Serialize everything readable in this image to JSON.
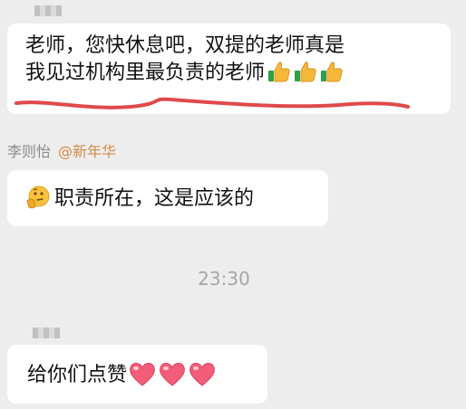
{
  "messages": [
    {
      "line1": "老师，您快休息吧，双提的老师真是",
      "line2": "我见过机构里最负责的老师",
      "emojis": [
        "thumbs-up",
        "thumbs-up",
        "thumbs-up"
      ]
    },
    {
      "sender_name": "李则怡",
      "mention": "@新年华",
      "text": "职责所在，这是应该的",
      "emoji": "thinking-face"
    },
    {
      "text": "给你们点赞",
      "emojis": [
        "heart",
        "heart",
        "heart"
      ]
    }
  ],
  "timestamp": "23:30",
  "colors": {
    "background": "#ededed",
    "bubble": "#ffffff",
    "underline": "#e0494b",
    "mention": "#d48a45",
    "timestamp": "#a6a6a6"
  }
}
